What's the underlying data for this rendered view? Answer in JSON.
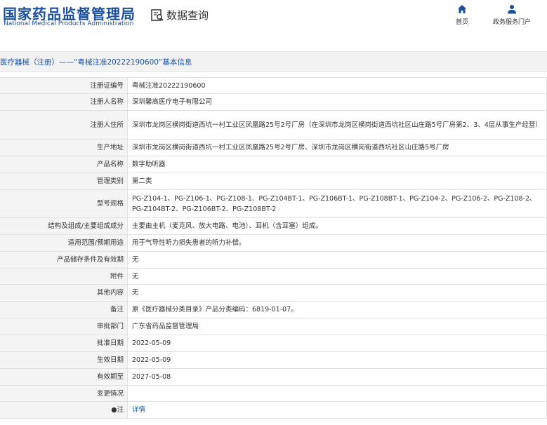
{
  "header": {
    "logo_cn": "国家药品监督管理局",
    "logo_en": "National Medical Products Administration",
    "query_label": "数据查询",
    "nav": [
      {
        "label": "首页",
        "icon": "home-icon"
      },
      {
        "label": "政务服务门户",
        "icon": "user-icon"
      }
    ]
  },
  "title": "医疗器械（注册）——“粤械注准20222190600”基本信息",
  "rows": [
    {
      "label": "注册证编号",
      "value": "粤械注准20222190600"
    },
    {
      "label": "注册人名称",
      "value": "深圳馨高医疗电子有限公司"
    },
    {
      "label": "注册人住所",
      "value": "深圳市龙岗区横岗街道西坑一村工业区凤凰路25号2号厂房（在深圳市龙岗区横岗街道西坑社区山庄路5号厂房第2、3、4层从事生产经营）"
    },
    {
      "label": "生产地址",
      "value": "深圳市龙岗区横岗街道西坑一村工业区凤凰路25号2号厂房、深圳市龙岗区横岗街道西坑社区山庄路5号厂房"
    },
    {
      "label": "产品名称",
      "value": "数字助听器"
    },
    {
      "label": "管理类别",
      "value": "第二类"
    },
    {
      "label": "型号规格",
      "value": "PG-Z104-1、PG-Z106-1、PG-Z108-1、PG-Z104BT-1、PG-Z106BT-1、PG-Z108BT-1、PG-Z104-2、PG-Z106-2、PG-Z108-2、PG-Z104BT-2、PG-Z106BT-2、PG-Z108BT-2"
    },
    {
      "label": "结构及组成/主要组成成分",
      "value": "主要由主机（麦克风、放大电路、电池）、耳机（含耳塞）组成。"
    },
    {
      "label": "适用范围/预期用途",
      "value": "用于气导性听力损失患者的听力补偿。"
    },
    {
      "label": "产品储存条件及有效期",
      "value": "无"
    },
    {
      "label": "附件",
      "value": "无"
    },
    {
      "label": "其他内容",
      "value": "无"
    },
    {
      "label": "备注",
      "value": "原《医疗器械分类目录》产品分类编码：6819-01-07。"
    },
    {
      "label": "审批部门",
      "value": "广东省药品监督管理局"
    },
    {
      "label": "批准日期",
      "value": "2022-05-09"
    },
    {
      "label": "生效日期",
      "value": "2022-05-09"
    },
    {
      "label": "有效期至",
      "value": "2027-05-08"
    },
    {
      "label": "变更情况",
      "value": ""
    },
    {
      "label": "●注",
      "value": "详情"
    }
  ],
  "colors": {
    "brand": "#1a4f9c",
    "link": "#1a5fb4",
    "label_bg": "#f4f4f4",
    "title_bg": "#f2f2f2"
  }
}
